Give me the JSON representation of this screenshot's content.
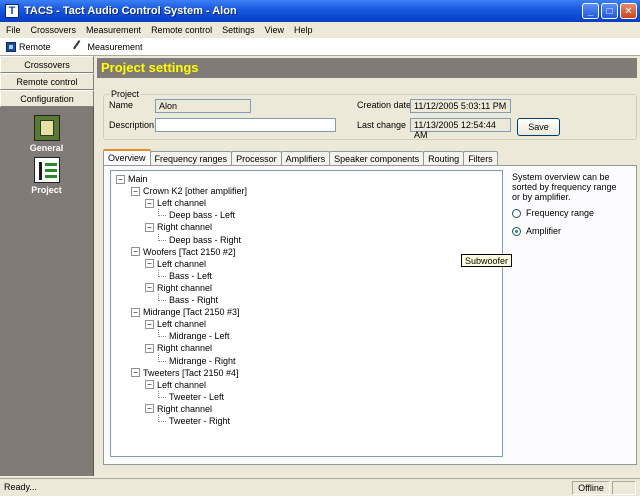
{
  "window": {
    "title": "TACS - Tact Audio Control System - Alon",
    "app_icon": "T",
    "minimize": "_",
    "maximize": "□",
    "close": "✕"
  },
  "menu": [
    "File",
    "Crossovers",
    "Measurement",
    "Remote control",
    "Settings",
    "View",
    "Help"
  ],
  "toolbar": {
    "remote": "Remote",
    "measurement": "Measurement"
  },
  "sidebar": {
    "buttons": [
      "Crossovers",
      "Remote control",
      "Configuration"
    ],
    "icons": [
      {
        "label": "General",
        "icon": "general-icon"
      },
      {
        "label": "Project",
        "icon": "project-icon"
      }
    ]
  },
  "header": {
    "title": "Project settings"
  },
  "project": {
    "legend": "Project",
    "name_label": "Name",
    "name_value": "Alon",
    "description_label": "Description",
    "description_value": "",
    "creation_label": "Creation date",
    "creation_value": "11/12/2005 5:03:11 PM",
    "last_change_label": "Last change",
    "last_change_value": "11/13/2005 12:54:44 AM",
    "save_label": "Save"
  },
  "tabs": [
    "Overview",
    "Frequency ranges",
    "Processor",
    "Amplifiers",
    "Speaker components",
    "Routing",
    "Filters"
  ],
  "active_tab": "Overview",
  "tree": [
    {
      "level": 0,
      "text": "Main",
      "expander": "−"
    },
    {
      "level": 1,
      "text": "Crown K2 [other amplifier]",
      "expander": "−"
    },
    {
      "level": 2,
      "text": "Left channel",
      "expander": "−"
    },
    {
      "level": 3,
      "text": "Deep bass - Left"
    },
    {
      "level": 2,
      "text": "Right channel",
      "expander": "−"
    },
    {
      "level": 3,
      "text": "Deep bass - Right"
    },
    {
      "level": 1,
      "text": "Woofers [Tact 2150 #2]",
      "expander": "−"
    },
    {
      "level": 2,
      "text": "Left channel",
      "expander": "−"
    },
    {
      "level": 3,
      "text": "Bass - Left"
    },
    {
      "level": 2,
      "text": "Right channel",
      "expander": "−"
    },
    {
      "level": 3,
      "text": "Bass - Right"
    },
    {
      "level": 1,
      "text": "Midrange [Tact 2150 #3]",
      "expander": "−"
    },
    {
      "level": 2,
      "text": "Left channel",
      "expander": "−"
    },
    {
      "level": 3,
      "text": "Midrange - Left"
    },
    {
      "level": 2,
      "text": "Right channel",
      "expander": "−"
    },
    {
      "level": 3,
      "text": "Midrange - Right"
    },
    {
      "level": 1,
      "text": "Tweeters [Tact 2150 #4]",
      "expander": "−"
    },
    {
      "level": 2,
      "text": "Left channel",
      "expander": "−"
    },
    {
      "level": 3,
      "text": "Tweeter - Left"
    },
    {
      "level": 2,
      "text": "Right channel",
      "expander": "−"
    },
    {
      "level": 3,
      "text": "Tweeter - Right"
    }
  ],
  "tooltip": "Subwoofer",
  "overview": {
    "info": "System overview can be sorted by frequency range or by amplifier.",
    "radio_frequency": "Frequency range",
    "radio_amplifier": "Amplifier",
    "selected": "Amplifier"
  },
  "status": {
    "left": "Ready...",
    "mode": "Offline"
  }
}
